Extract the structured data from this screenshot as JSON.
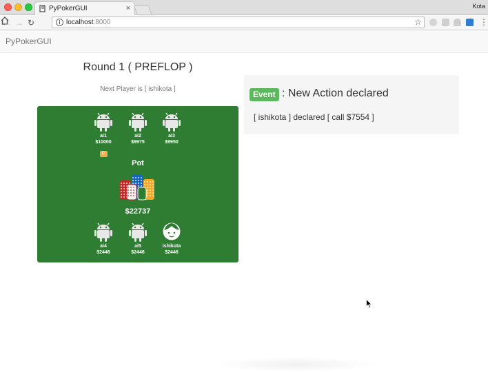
{
  "browser": {
    "tab_title": "PyPokerGUI",
    "tab_close": "×",
    "url_host": "localhost",
    "url_port": ":8000",
    "profile_name": "Kota",
    "icons": {
      "back": "arrow-left-icon",
      "forward": "arrow-right-icon",
      "reload": "reload-icon",
      "home": "home-icon",
      "info": "info-icon",
      "bookmark": "star-icon",
      "menu": "menu-dots-icon"
    },
    "glyphs": {
      "back": "←",
      "forward": "→",
      "reload": "↻",
      "info": "i",
      "star": "☆",
      "menu": "⋮"
    }
  },
  "app": {
    "brand": "PyPokerGUI"
  },
  "game": {
    "round_title": "Round 1 ( PREFLOP )",
    "next_player": "Next Player is [ ishikota ]",
    "table_color": "#2e7d32",
    "players": [
      {
        "name": "ai1",
        "stack": "$10000",
        "avatar": "android-icon",
        "dealer": true
      },
      {
        "name": "ai2",
        "stack": "$9975",
        "avatar": "android-icon",
        "dealer": false
      },
      {
        "name": "ai3",
        "stack": "$9950",
        "avatar": "android-icon",
        "dealer": false
      },
      {
        "name": "ai4",
        "stack": "$2446",
        "avatar": "android-icon",
        "dealer": false
      },
      {
        "name": "ai5",
        "stack": "$2446",
        "avatar": "android-icon",
        "dealer": false
      },
      {
        "name": "ishikota",
        "stack": "$2446",
        "avatar": "face-icon",
        "dealer": false
      }
    ],
    "dealer_button": "D",
    "pot_label": "Pot",
    "pot_amount": "$22737",
    "pot_icon": "chip-stack-icon"
  },
  "event": {
    "badge": "Event",
    "title": ": New Action declared",
    "message": "[ ishikota ] declared [ call $7554 ]",
    "badge_color": "#5cb85c"
  }
}
